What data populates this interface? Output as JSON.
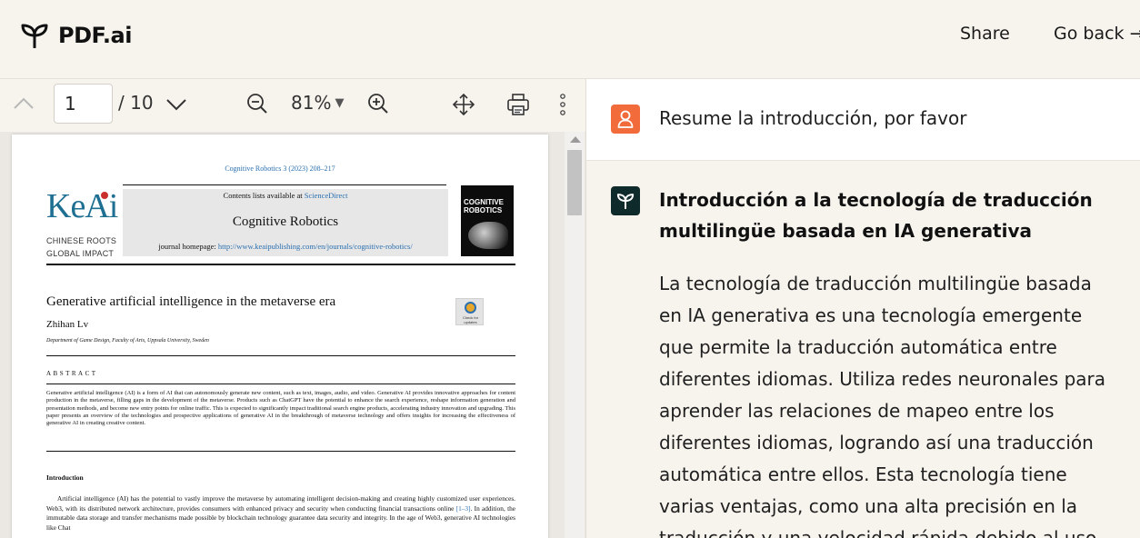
{
  "header": {
    "brand": "PDF.ai",
    "share_label": "Share",
    "back_label": "Go back →"
  },
  "toolbar": {
    "page_value": "1",
    "page_total": "/ 10",
    "zoom": "81%"
  },
  "pdf": {
    "citation": "Cognitive Robotics 3 (2023) 208–217",
    "publisher_logo": "KeAi",
    "publisher_sub_1": "CHINESE ROOTS",
    "publisher_sub_2": "GLOBAL IMPACT",
    "contents_prefix": "Contents lists available at ",
    "contents_link": "ScienceDirect",
    "journal_title": "Cognitive Robotics",
    "homepage_prefix": "journal homepage: ",
    "homepage_url": "http://www.keaipublishing.com/en/journals/cognitive-robotics/",
    "cover_title_1": "COGNITIVE",
    "cover_title_2": "ROBOTICS",
    "badge_label": "Check for updates",
    "article_title": "Generative artificial intelligence in the metaverse era",
    "author": "Zhihan Lv",
    "affiliation": "Department of Game Design, Faculty of Arts, Uppsala University, Sweden",
    "abstract_heading": "ABSTRACT",
    "abstract_text": "Generative artificial intelligence (AI) is a form of AI that can autonomously generate new content, such as text, images, audio, and video. Generative AI provides innovative approaches for content production in the metaverse, filling gaps in the development of the metaverse. Products such as ChatGPT have the potential to enhance the search experience, reshape information generation and presentation methods, and become new entry points for online traffic. This is expected to significantly impact traditional search engine products, accelerating industry innovation and upgrading. This paper presents an overview of the technologies and prospective applications of generative AI in the breakthrough of metaverse technology and offers insights for increasing the effectiveness of generative AI in creating creative content.",
    "intro_heading": "Introduction",
    "intro_text_1": "Artificial intelligence (AI) has the potential to vastly improve the metaverse by automating intelligent decision-making and creating highly customized user experiences. Web3, with its distributed network architecture, provides consumers with enhanced privacy and security when conducting financial transactions online ",
    "intro_ref": "[1–3]",
    "intro_text_2": ". In addition, the immutable data storage and transfer mechanisms made possible by blockchain technology guarantee data security and integrity. In the age of Web3, generative AI technologies like Chat"
  },
  "chat": {
    "user_message": "Resume la introducción, por favor",
    "answer_title": "Introducción a la tecnología de traducción multilingüe basada en IA generativa",
    "answer_body": "La tecnología de traducción multilingüe basada en IA generativa es una tecnología emergente que permite la traducción automática entre diferentes idiomas. Utiliza redes neuronales para aprender las relaciones de mapeo entre los diferentes idiomas, logrando así una traducción automática entre ellos. Esta tecnología tiene varias ventajas, como una alta precisión en la traducción y una velocidad rápida debido al uso"
  },
  "colors": {
    "user_avatar": "#f26b3a",
    "bot_avatar": "#0f2a2b",
    "link": "#2a6fb0",
    "keai": "#1e6f91"
  },
  "icons": {
    "logo": "sprout-icon",
    "prev_page": "chevron-up-icon",
    "next_page": "chevron-down-icon",
    "zoom_out": "zoom-out-icon",
    "zoom_in": "zoom-in-icon",
    "pan": "move-icon",
    "print": "printer-icon",
    "more": "more-vertical-icon",
    "user": "user-icon",
    "bot": "sprout-icon"
  }
}
